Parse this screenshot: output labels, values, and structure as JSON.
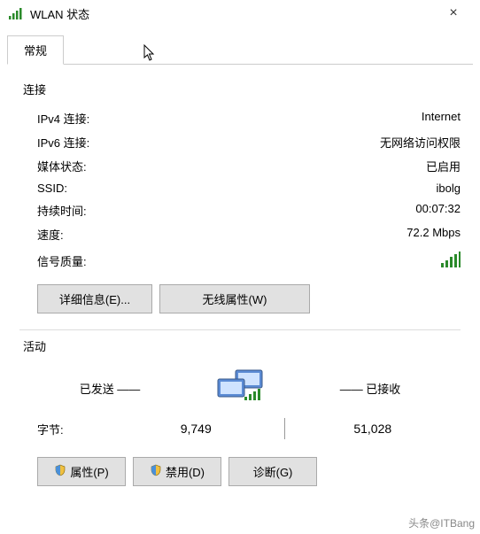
{
  "window": {
    "title": "WLAN 状态",
    "close_label": "×"
  },
  "tabs": {
    "general": "常规"
  },
  "connection": {
    "section": "连接",
    "ipv4_label": "IPv4 连接",
    "ipv4_value": "Internet",
    "ipv6_label": "IPv6 连接",
    "ipv6_value": "无网络访问权限",
    "media_label": "媒体状态",
    "media_value": "已启用",
    "ssid_label": "SSID",
    "ssid_value": "ibolg",
    "duration_label": "持续时间",
    "duration_value": "00:07:32",
    "speed_label": "速度",
    "speed_value": "72.2 Mbps",
    "signal_label": "信号质量"
  },
  "buttons": {
    "details": "详细信息(E)...",
    "wireless_props": "无线属性(W)",
    "properties": "属性(P)",
    "disable": "禁用(D)",
    "diagnose": "诊断(G)"
  },
  "activity": {
    "section": "活动",
    "sent_label": "已发送 ——",
    "recv_label": "—— 已接收",
    "bytes_label": "字节:",
    "sent_bytes": "9,749",
    "recv_bytes": "51,028"
  },
  "watermark": "头条@ITBang"
}
